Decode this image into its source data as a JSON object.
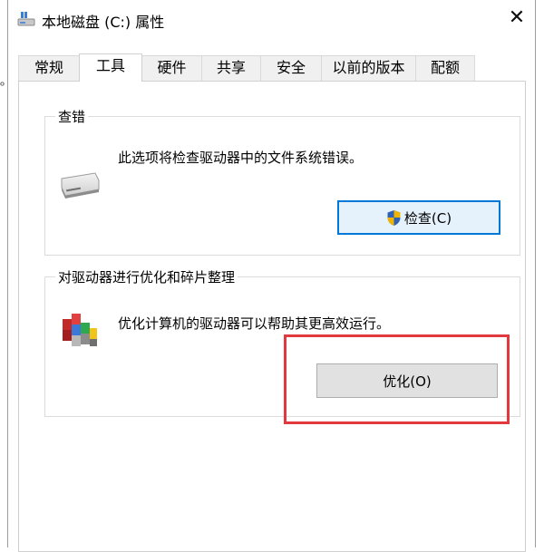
{
  "backdrop": {
    "edge_text": "ᵒ"
  },
  "window": {
    "title": "本地磁盘 (C:) 属性",
    "close_glyph": "✕"
  },
  "tabs": [
    {
      "label": "常规"
    },
    {
      "label": "工具"
    },
    {
      "label": "硬件"
    },
    {
      "label": "共享"
    },
    {
      "label": "安全"
    },
    {
      "label": "以前的版本"
    },
    {
      "label": "配额"
    }
  ],
  "active_tab": "工具",
  "error_check": {
    "group_label": "查错",
    "description": "此选项将检查驱动器中的文件系统错误。",
    "button_label": "检查(C)",
    "icon": "drive-icon",
    "button_icon": "uac-shield-icon"
  },
  "optimize": {
    "group_label": "对驱动器进行优化和碎片整理",
    "description": "优化计算机的驱动器可以帮助其更高效运行。",
    "button_label": "优化(O)",
    "icon": "defrag-icon"
  },
  "colors": {
    "highlight": "#e0393e",
    "focus_border": "#0078d7",
    "button_bg": "#e1e1e1"
  }
}
